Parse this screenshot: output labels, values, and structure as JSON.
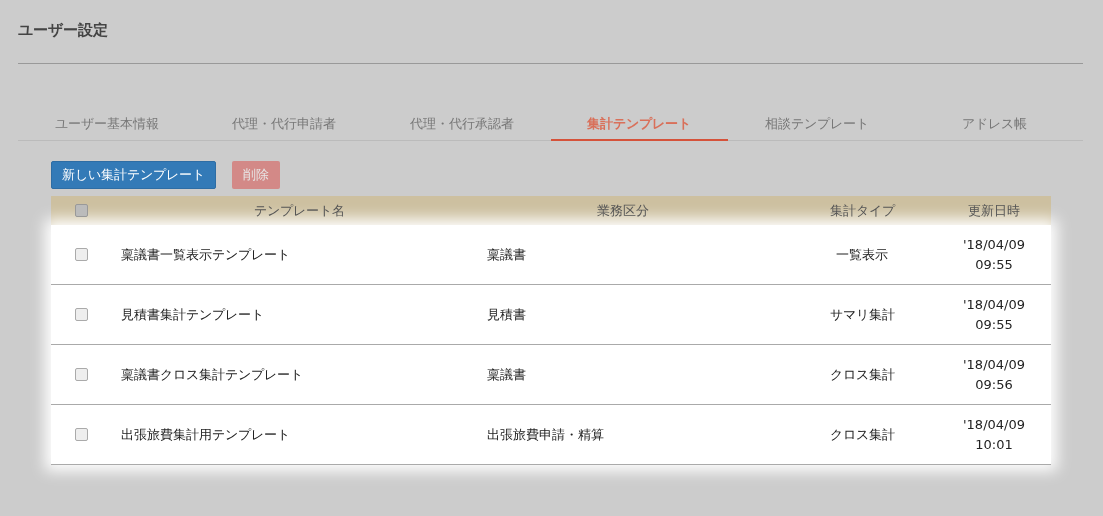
{
  "page_title": "ユーザー設定",
  "tabs": [
    {
      "label": "ユーザー基本情報",
      "selected": false
    },
    {
      "label": "代理・代行申請者",
      "selected": false
    },
    {
      "label": "代理・代行承認者",
      "selected": false
    },
    {
      "label": "集計テンプレート",
      "selected": true
    },
    {
      "label": "相談テンプレート",
      "selected": false
    },
    {
      "label": "アドレス帳",
      "selected": false
    }
  ],
  "buttons": [
    {
      "label": "新しい集計テンプレート",
      "kind": "primary",
      "disabled": false
    },
    {
      "label": "削除",
      "kind": "danger",
      "disabled": true
    }
  ],
  "table": {
    "select_all_checked": false,
    "columns": [
      "テンプレート名",
      "業務区分",
      "集計タイプ",
      "更新日時"
    ],
    "rows": [
      {
        "checked": false,
        "name": "稟議書一覧表示テンプレート",
        "category": "稟議書",
        "type": "一覧表示",
        "date": "'18/04/09",
        "time": "09:55"
      },
      {
        "checked": false,
        "name": "見積書集計テンプレート",
        "category": "見積書",
        "type": "サマリ集計",
        "date": "'18/04/09",
        "time": "09:55"
      },
      {
        "checked": false,
        "name": "稟議書クロス集計テンプレート",
        "category": "稟議書",
        "type": "クロス集計",
        "date": "'18/04/09",
        "time": "09:56"
      },
      {
        "checked": false,
        "name": "出張旅費集計用テンプレート",
        "category": "出張旅費申請・精算",
        "type": "クロス集計",
        "date": "'18/04/09",
        "time": "10:01"
      }
    ]
  }
}
